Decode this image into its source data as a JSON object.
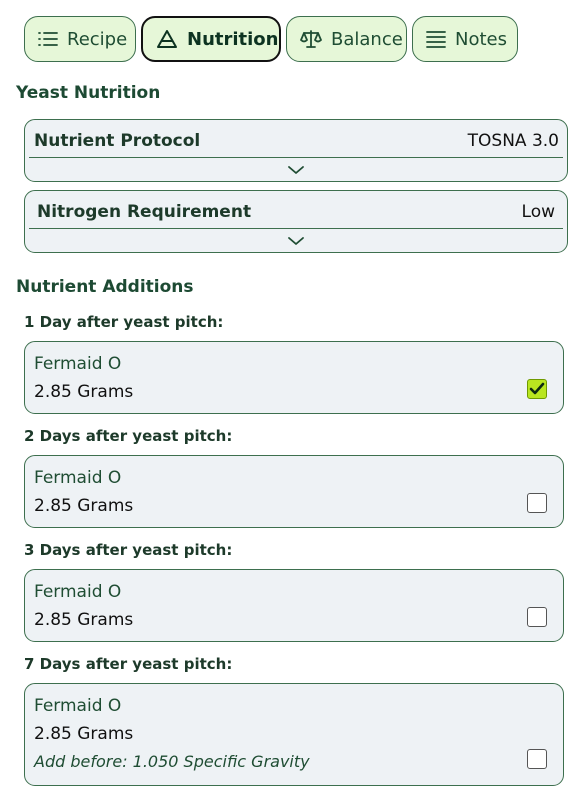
{
  "tabs": [
    {
      "label": "Recipe",
      "icon": "list-icon",
      "active": false
    },
    {
      "label": "Nutrition",
      "icon": "triangle-icon",
      "active": true
    },
    {
      "label": "Balance",
      "icon": "scale-icon",
      "active": false
    },
    {
      "label": "Notes",
      "icon": "notes-icon",
      "active": false
    }
  ],
  "yeast_nutrition": {
    "title": "Yeast Nutrition",
    "protocol": {
      "label": "Nutrient Protocol",
      "value": "TOSNA 3.0"
    },
    "nitrogen": {
      "label": "Nitrogen Requirement",
      "value": "Low"
    }
  },
  "additions": {
    "title": "Nutrient Additions",
    "items": [
      {
        "day": "1 Day after yeast pitch:",
        "name": "Fermaid O",
        "amount": "2.85 Grams",
        "note": "",
        "checked": true
      },
      {
        "day": "2 Days after yeast pitch:",
        "name": "Fermaid O",
        "amount": "2.85 Grams",
        "note": "",
        "checked": false
      },
      {
        "day": "3 Days after yeast pitch:",
        "name": "Fermaid O",
        "amount": "2.85 Grams",
        "note": "",
        "checked": false
      },
      {
        "day": "7 Days after yeast pitch:",
        "name": "Fermaid O",
        "amount": "2.85 Grams",
        "note": "Add before: 1.050 Specific Gravity",
        "checked": false
      }
    ]
  },
  "colors": {
    "accent": "#e6f7d8",
    "border": "#3d6f4e",
    "card": "#eef2f5",
    "check": "#b9e620"
  }
}
